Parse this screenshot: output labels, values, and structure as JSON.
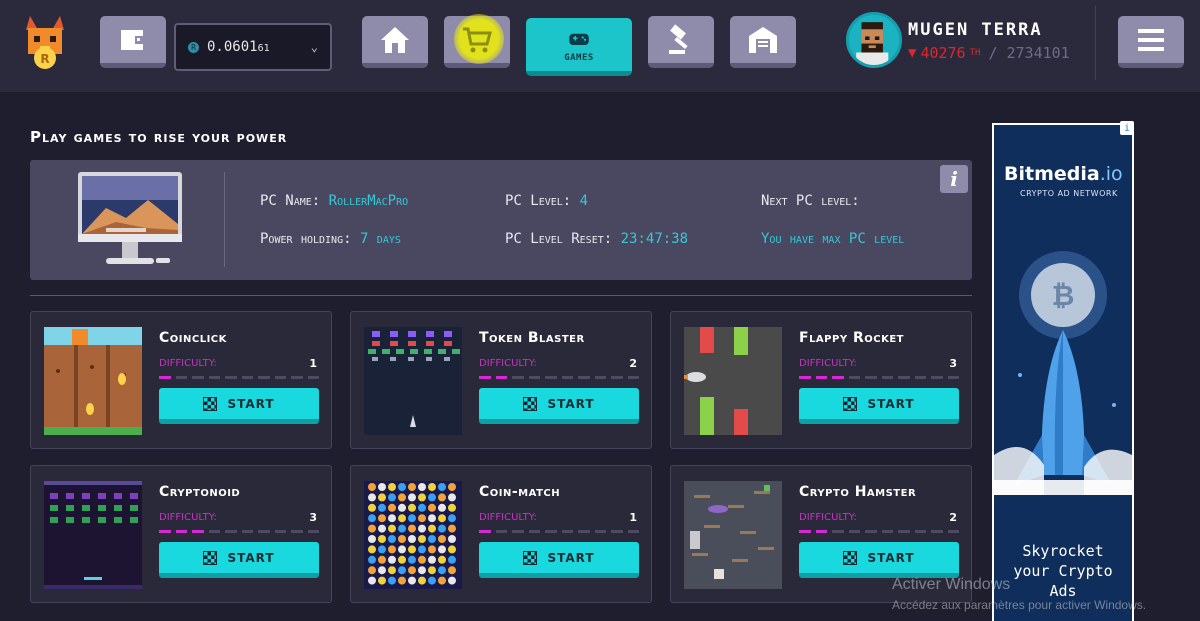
{
  "header": {
    "wallet": {
      "amount_main": "0.0601",
      "amount_small": "61",
      "coin_icon": "rollercoin-coin-icon",
      "dropdown_icon": "chevron-down-icon"
    },
    "nav": [
      {
        "name": "nav-wallet-button",
        "icon": "wallet-icon"
      },
      {
        "name": "nav-home-button",
        "icon": "house-icon"
      },
      {
        "name": "nav-marketplace-button",
        "icon": "shopping-cart-icon"
      },
      {
        "name": "nav-games-button",
        "icon": "gamepad-icon",
        "label": "GAMES",
        "active": true
      },
      {
        "name": "nav-auction-button",
        "icon": "gavel-icon"
      },
      {
        "name": "nav-storage-button",
        "icon": "warehouse-icon"
      }
    ],
    "user": {
      "name": "MUGEN TERRA",
      "rank": "40276",
      "rank_suffix": "TH",
      "total": "/ 2734101",
      "trend_icon": "down-triangle-icon"
    },
    "menu_icon": "hamburger-menu-icon"
  },
  "page": {
    "title": "Play games to rise your power"
  },
  "pc": {
    "name_label": "PC Name:",
    "name_value": "RollerMacPro",
    "holding_label": "Power holding:",
    "holding_value": "7 days",
    "level_label": "PC Level:",
    "level_value": "4",
    "reset_label": "PC Level Reset:",
    "reset_value": "23:47:38",
    "next_label": "Next PC level:",
    "next_value": "You have max PC level",
    "info_label": "i"
  },
  "games": [
    {
      "title": "Coinclick",
      "difficulty_label": "DIFFICULTY:",
      "difficulty": 1,
      "start_label": "START"
    },
    {
      "title": "Token Blaster",
      "difficulty_label": "DIFFICULTY:",
      "difficulty": 2,
      "start_label": "START"
    },
    {
      "title": "Flappy Rocket",
      "difficulty_label": "DIFFICULTY:",
      "difficulty": 3,
      "start_label": "START"
    },
    {
      "title": "Cryptonoid",
      "difficulty_label": "DIFFICULTY:",
      "difficulty": 3,
      "start_label": "START"
    },
    {
      "title": "Coin-match",
      "difficulty_label": "DIFFICULTY:",
      "difficulty": 1,
      "start_label": "START"
    },
    {
      "title": "Crypto Hamster",
      "difficulty_label": "DIFFICULTY:",
      "difficulty": 2,
      "start_label": "START"
    }
  ],
  "ad": {
    "brand": "Bitmedia",
    "brand_suffix": ".io",
    "subtitle": "CRYPTO AD NETWORK",
    "cta_line1": "Skyrocket",
    "cta_line2": "your Crypto",
    "cta_line3": "Ads",
    "info_label": "i"
  },
  "windows_watermark": {
    "line1": "Activer Windows",
    "line2": "Accédez aux paramètres pour activer Windows."
  },
  "colors": {
    "accent": "#1ad9de",
    "background": "#1f1e2e",
    "header": "#2b2a3c",
    "difficulty": "#d42ad4",
    "rank_down": "#d9282f"
  }
}
